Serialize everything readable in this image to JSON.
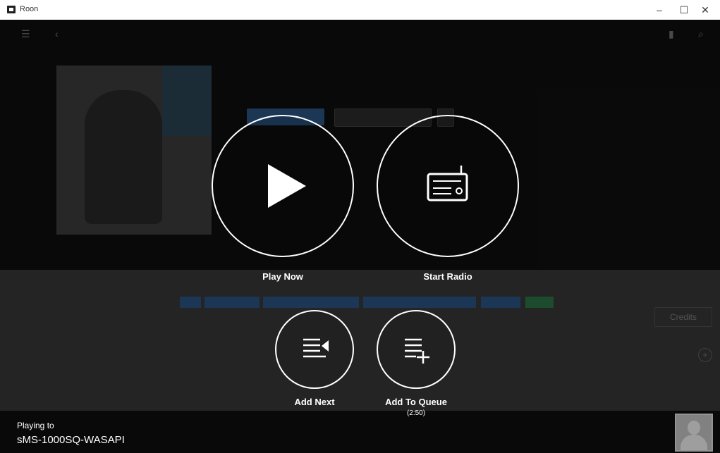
{
  "window": {
    "title": "Roon",
    "minimize": "–",
    "maximize": "☐",
    "close": "✕"
  },
  "background": {
    "credits_label": "Credits"
  },
  "actions": {
    "play_now": "Play Now",
    "start_radio": "Start Radio",
    "add_next": "Add Next",
    "add_to_queue": "Add To Queue",
    "add_to_queue_duration": "(2:50)"
  },
  "now_playing": {
    "playing_to_label": "Playing to",
    "zone_name": "sMS-1000SQ-WASAPI"
  },
  "colors": {
    "overlay": "#000000",
    "accent": "#2c5a8a"
  }
}
